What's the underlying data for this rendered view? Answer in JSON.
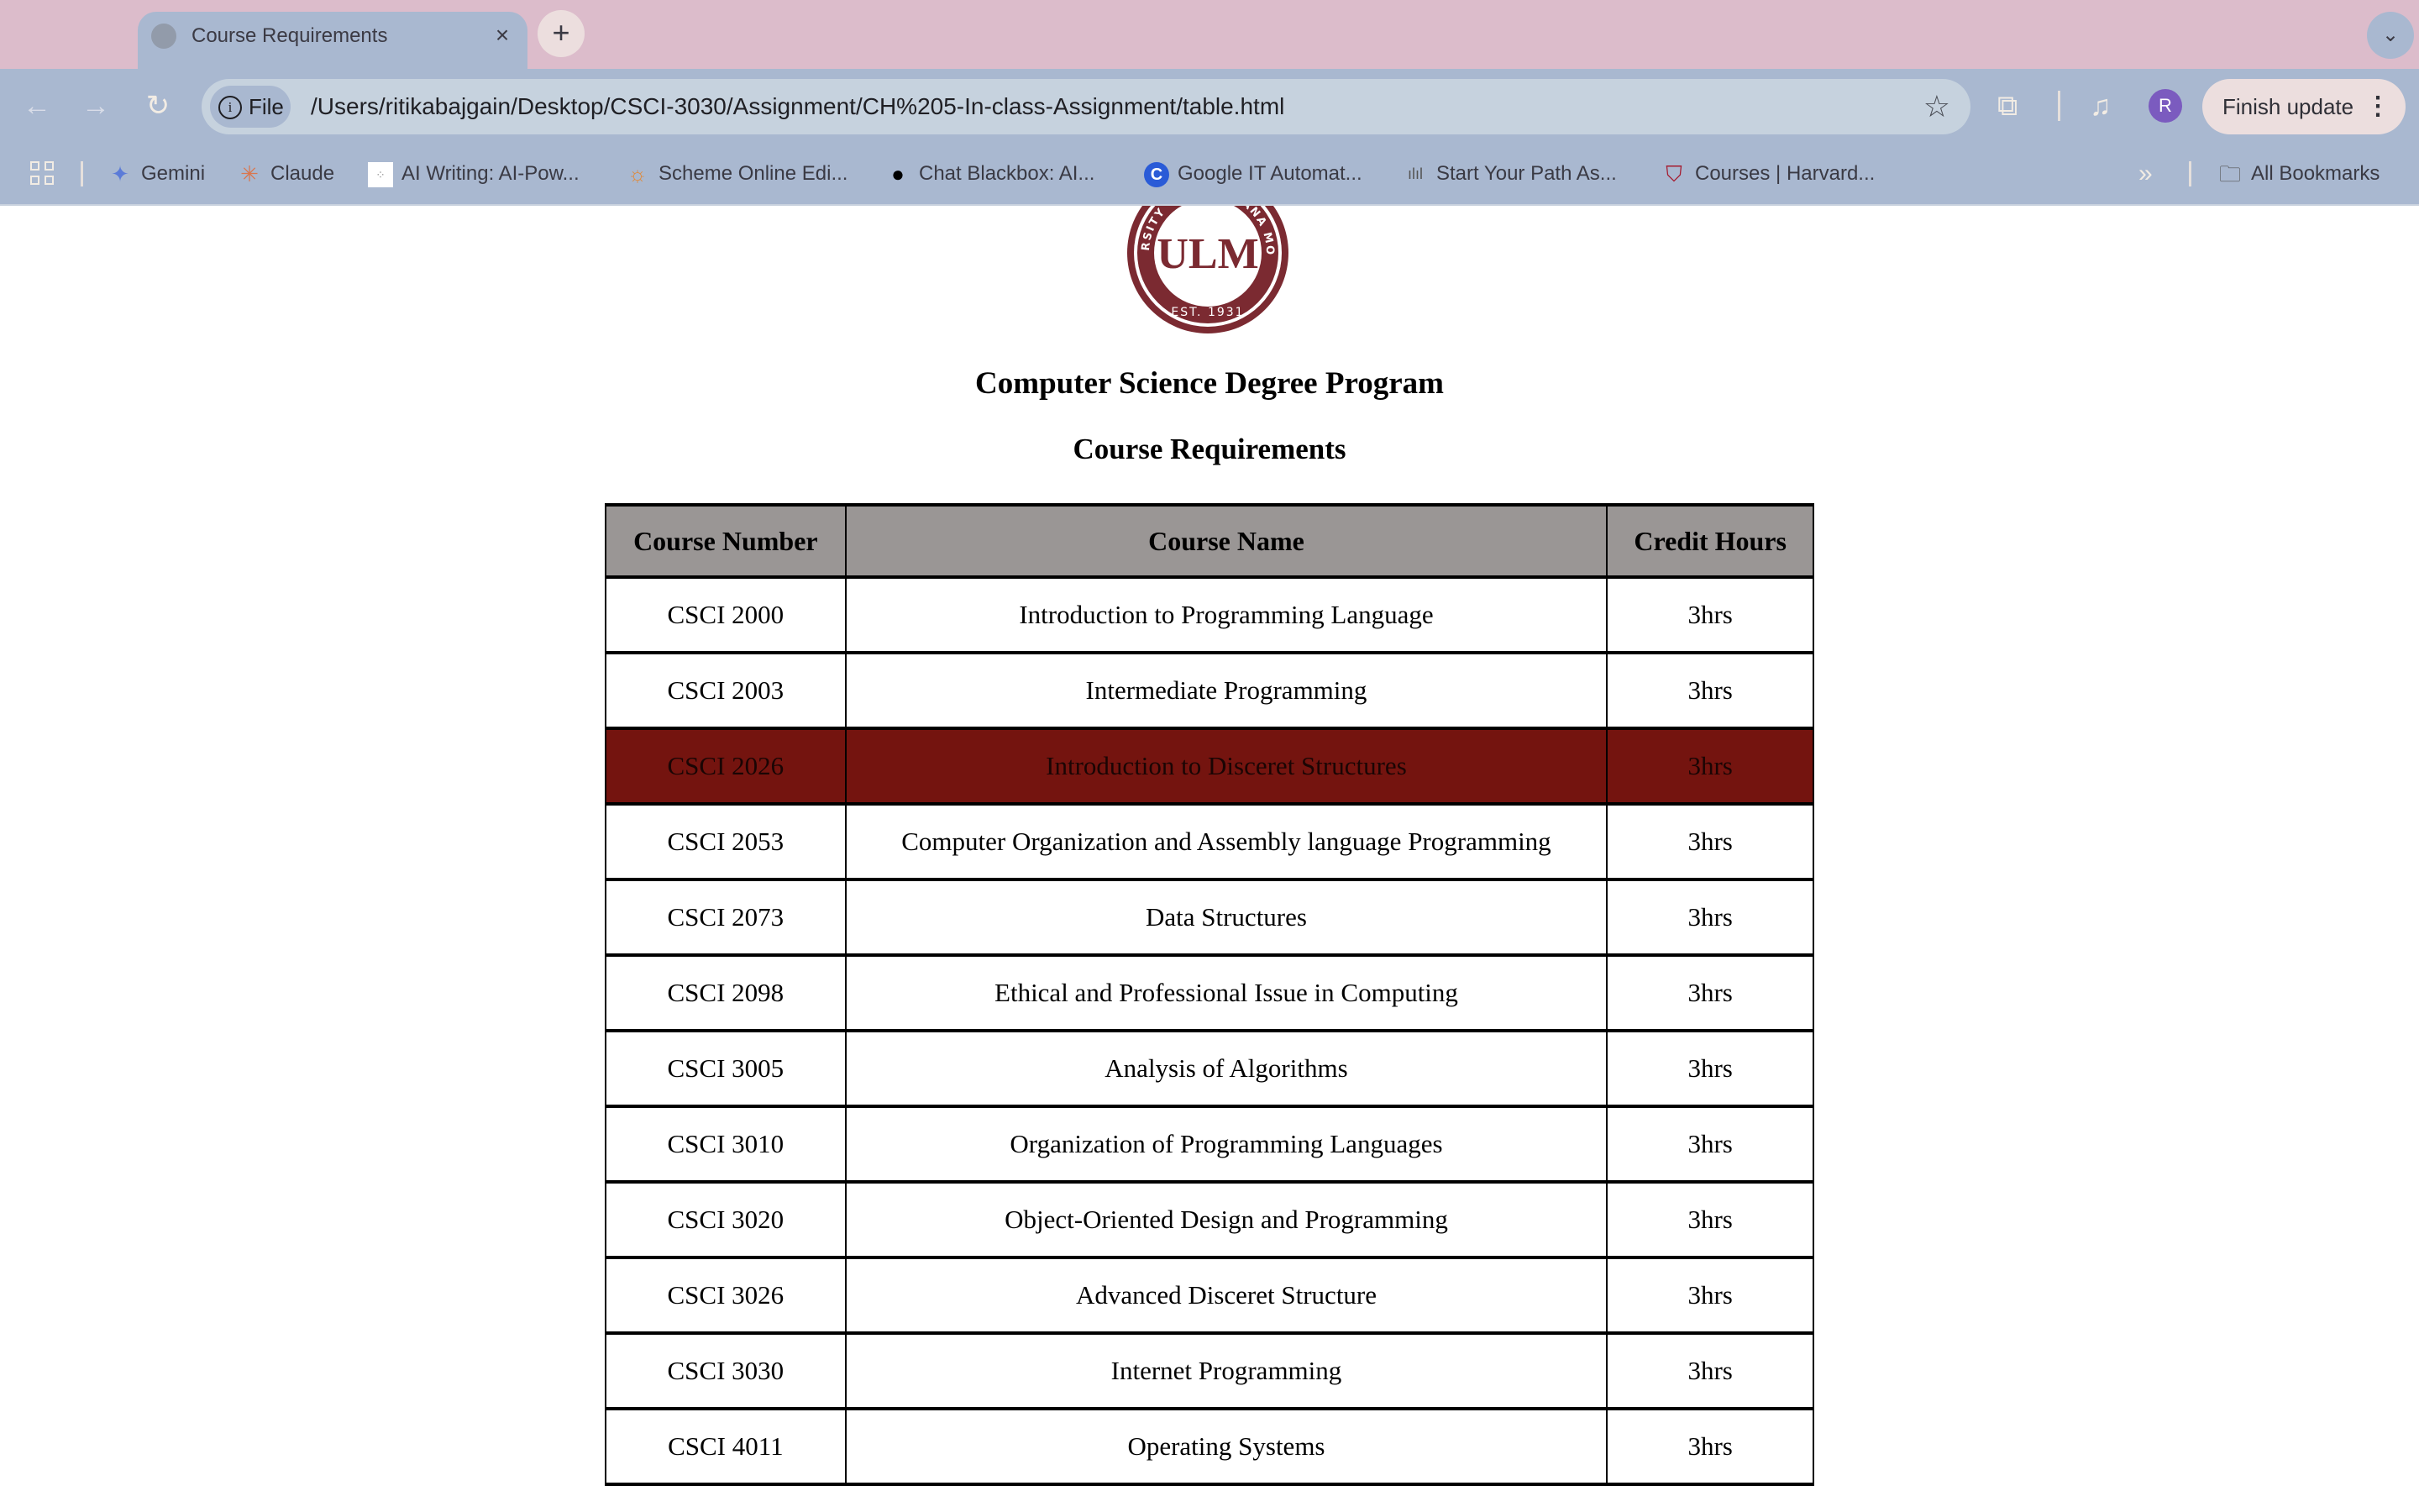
{
  "browser": {
    "tab": {
      "title": "Course Requirements",
      "close_icon": "×"
    },
    "new_tab_label": "+",
    "tab_search_icon": "⌄",
    "nav": {
      "back": "←",
      "forward": "→",
      "reload": "↻"
    },
    "omnibox": {
      "scheme_chip": "File",
      "url": "/Users/ritikabajgain/Desktop/CSCI-3030/Assignment/CH%205-In-class-Assignment/table.html"
    },
    "profile_initial": "R",
    "update_button": "Finish update",
    "bookmarks": [
      {
        "label": "Gemini",
        "icon": "gemini-icon"
      },
      {
        "label": "Claude",
        "icon": "claude-icon"
      },
      {
        "label": "AI Writing: AI-Pow...",
        "icon": "ai-writing-icon"
      },
      {
        "label": "Scheme Online Edi...",
        "icon": "scheme-icon"
      },
      {
        "label": "Chat Blackbox: AI...",
        "icon": "blackbox-icon"
      },
      {
        "label": "Google IT Automat...",
        "icon": "coursera-icon"
      },
      {
        "label": "Start Your Path As...",
        "icon": "cisco-icon"
      },
      {
        "label": "Courses | Harvard...",
        "icon": "harvard-icon"
      }
    ],
    "overflow_label": "»",
    "all_bookmarks": "All Bookmarks"
  },
  "page": {
    "logo": {
      "top_text": "UNIVERSITY OF LOUISIANA MONROE",
      "monogram": "ULM",
      "est": "EST. 1931",
      "color": "#7b2a31"
    },
    "title": "Computer Science Degree Program",
    "subtitle": "Course Requirements",
    "table": {
      "headers": [
        "Course Number",
        "Course Name",
        "Credit Hours"
      ],
      "highlight_color": "#74140f",
      "header_color": "#9a9695",
      "rows": [
        {
          "number": "CSCI 2000",
          "name": "Introduction to Programming Language",
          "hours": "3hrs"
        },
        {
          "number": "CSCI 2003",
          "name": "Intermediate Programming",
          "hours": "3hrs"
        },
        {
          "number": "CSCI 2026",
          "name": "Introduction to Disceret Structures",
          "hours": "3hrs",
          "highlighted": true
        },
        {
          "number": "CSCI 2053",
          "name": "Computer Organization and Assembly language Programming",
          "hours": "3hrs"
        },
        {
          "number": "CSCI 2073",
          "name": "Data Structures",
          "hours": "3hrs"
        },
        {
          "number": "CSCI 2098",
          "name": "Ethical and Professional Issue in Computing",
          "hours": "3hrs"
        },
        {
          "number": "CSCI 3005",
          "name": "Analysis of Algorithms",
          "hours": "3hrs"
        },
        {
          "number": "CSCI 3010",
          "name": "Organization of Programming Languages",
          "hours": "3hrs"
        },
        {
          "number": "CSCI 3020",
          "name": "Object-Oriented Design and Programming",
          "hours": "3hrs"
        },
        {
          "number": "CSCI 3026",
          "name": "Advanced Disceret Structure",
          "hours": "3hrs"
        },
        {
          "number": "CSCI 3030",
          "name": "Internet Programming",
          "hours": "3hrs"
        },
        {
          "number": "CSCI 4011",
          "name": "Operating Systems",
          "hours": "3hrs"
        }
      ]
    }
  }
}
